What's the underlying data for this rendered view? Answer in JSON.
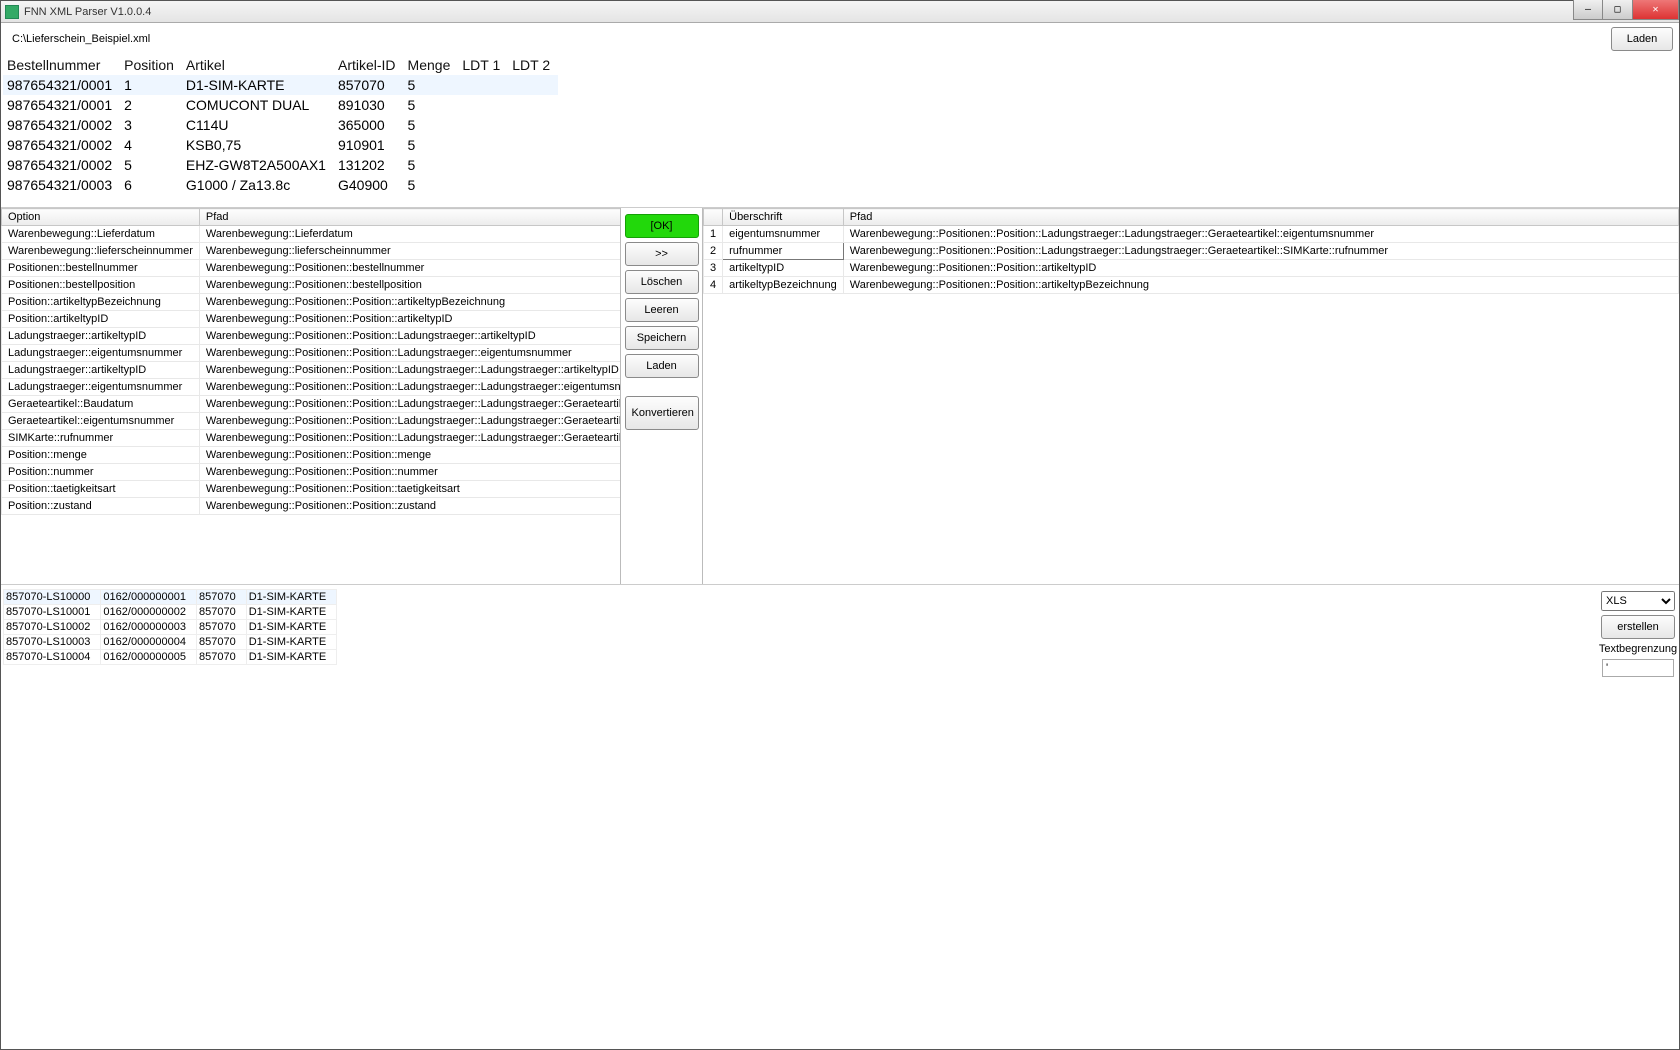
{
  "window": {
    "title": "FNN XML Parser V1.0.0.4"
  },
  "path": {
    "value": "C:\\Lieferschein_Beispiel.xml",
    "load_btn": "Laden"
  },
  "top_table": {
    "headers": [
      "Bestellnummer",
      "Position",
      "Artikel",
      "Artikel-ID",
      "Menge",
      "LDT 1",
      "LDT 2"
    ],
    "rows": [
      [
        "987654321/0001",
        "1",
        "D1-SIM-KARTE",
        "857070",
        "5",
        "",
        ""
      ],
      [
        "987654321/0001",
        "2",
        "COMUCONT DUAL",
        "891030",
        "5",
        "",
        ""
      ],
      [
        "987654321/0002",
        "3",
        "C114U",
        "365000",
        "5",
        "",
        ""
      ],
      [
        "987654321/0002",
        "4",
        "KSB0,75",
        "910901",
        "5",
        "",
        ""
      ],
      [
        "987654321/0002",
        "5",
        "EHZ-GW8T2A500AX1",
        "131202",
        "5",
        "",
        ""
      ],
      [
        "987654321/0003",
        "6",
        "G1000 / Za13.8c",
        "G40900",
        "5",
        "",
        ""
      ]
    ]
  },
  "left_grid": {
    "headers": [
      "Option",
      "Pfad"
    ],
    "rows": [
      [
        "Warenbewegung::Lieferdatum",
        "Warenbewegung::Lieferdatum"
      ],
      [
        "Warenbewegung::lieferscheinnummer",
        "Warenbewegung::lieferscheinnummer"
      ],
      [
        "Positionen::bestellnummer",
        "Warenbewegung::Positionen::bestellnummer"
      ],
      [
        "Positionen::bestellposition",
        "Warenbewegung::Positionen::bestellposition"
      ],
      [
        "Position::artikeltypBezeichnung",
        "Warenbewegung::Positionen::Position::artikeltypBezeichnung"
      ],
      [
        "Position::artikeltypID",
        "Warenbewegung::Positionen::Position::artikeltypID"
      ],
      [
        "Ladungstraeger::artikeltypID",
        "Warenbewegung::Positionen::Position::Ladungstraeger::artikeltypID"
      ],
      [
        "Ladungstraeger::eigentumsnummer",
        "Warenbewegung::Positionen::Position::Ladungstraeger::eigentumsnummer"
      ],
      [
        "Ladungstraeger::artikeltypID",
        "Warenbewegung::Positionen::Position::Ladungstraeger::Ladungstraeger::artikeltypID"
      ],
      [
        "Ladungstraeger::eigentumsnummer",
        "Warenbewegung::Positionen::Position::Ladungstraeger::Ladungstraeger::eigentumsnummer"
      ],
      [
        "Geraeteartikel::Baudatum",
        "Warenbewegung::Positionen::Position::Ladungstraeger::Ladungstraeger::Geraeteartikel::Baudatum"
      ],
      [
        "Geraeteartikel::eigentumsnummer",
        "Warenbewegung::Positionen::Position::Ladungstraeger::Ladungstraeger::Geraeteartikel::eigentumsnummer"
      ],
      [
        "SIMKarte::rufnummer",
        "Warenbewegung::Positionen::Position::Ladungstraeger::Ladungstraeger::Geraeteartikel::SIMKarte::rufnummer"
      ],
      [
        "Position::menge",
        "Warenbewegung::Positionen::Position::menge"
      ],
      [
        "Position::nummer",
        "Warenbewegung::Positionen::Position::nummer"
      ],
      [
        "Position::taetigkeitsart",
        "Warenbewegung::Positionen::Position::taetigkeitsart"
      ],
      [
        "Position::zustand",
        "Warenbewegung::Positionen::Position::zustand"
      ]
    ]
  },
  "mid_buttons": {
    "ok": "[OK]",
    "move": ">>",
    "delete": "Löschen",
    "clear": "Leeren",
    "save": "Speichern",
    "load": "Laden",
    "convert": "Konvertieren"
  },
  "right_grid": {
    "headers": [
      "",
      "Überschrift",
      "Pfad"
    ],
    "rows": [
      [
        "1",
        "eigentumsnummer",
        "Warenbewegung::Positionen::Position::Ladungstraeger::Ladungstraeger::Geraeteartikel::eigentumsnummer"
      ],
      [
        "2",
        "rufnummer",
        "Warenbewegung::Positionen::Position::Ladungstraeger::Ladungstraeger::Geraeteartikel::SIMKarte::rufnummer"
      ],
      [
        "3",
        "artikeltypID",
        "Warenbewegung::Positionen::Position::artikeltypID"
      ],
      [
        "4",
        "artikeltypBezeichnung",
        "Warenbewegung::Positionen::Position::artikeltypBezeichnung"
      ]
    ],
    "editing_row": 1
  },
  "result_grid": {
    "rows": [
      [
        "857070-LS10000",
        "0162/000000001",
        "857070",
        "D1-SIM-KARTE"
      ],
      [
        "857070-LS10001",
        "0162/000000002",
        "857070",
        "D1-SIM-KARTE"
      ],
      [
        "857070-LS10002",
        "0162/000000003",
        "857070",
        "D1-SIM-KARTE"
      ],
      [
        "857070-LS10003",
        "0162/000000004",
        "857070",
        "D1-SIM-KARTE"
      ],
      [
        "857070-LS10004",
        "0162/000000005",
        "857070",
        "D1-SIM-KARTE"
      ]
    ]
  },
  "export": {
    "format_options": [
      "XLS"
    ],
    "format_selected": "XLS",
    "create_btn": "erstellen",
    "delimiter_label": "Textbegrenzung",
    "delimiter_value": "'"
  }
}
